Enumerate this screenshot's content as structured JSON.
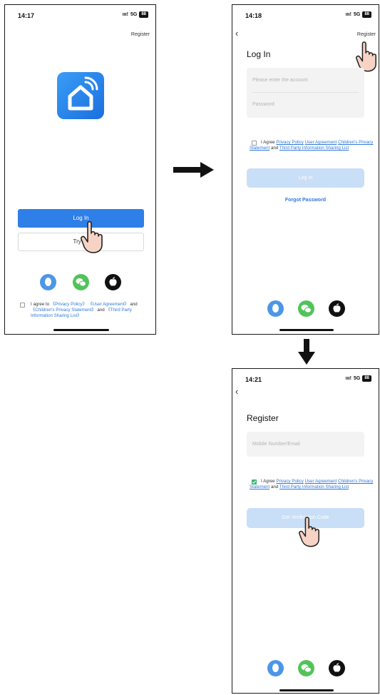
{
  "colors": {
    "accent": "#2f7fe8",
    "link": "#2f78d8",
    "faded_button": "#c9def7",
    "check_green": "#3cb371",
    "qq_blue": "#4c96e8",
    "wechat_green": "#52c35a",
    "apple_black": "#111111"
  },
  "screen1": {
    "time": "14:17",
    "status_right": "5G",
    "battery": "88",
    "register_label": "Register",
    "app_icon": "smart-home-icon",
    "login_button": "Log In",
    "try_button": "Try as",
    "agree_text": "I agree to",
    "privacy_link": "《Privacy Policy》",
    "user_agreement_link": "《User Agreement》",
    "and1": "and",
    "children_link": "《Children's Privacy Statement》",
    "and2": "and",
    "third_party_link": "《Third Party Information Sharing List》"
  },
  "screen2": {
    "time": "14:18",
    "status_right": "5G",
    "battery": "88",
    "register_label": "Register",
    "title": "Log In",
    "account_placeholder": "Please enter the account",
    "password_placeholder": "Password",
    "agree_text": "I Agree",
    "privacy_link": "Privacy Policy",
    "user_agreement_link": "User Agreement",
    "children_link": "Children's Privacy Statement",
    "and_text": "and",
    "third_party_link": "Third Party Information Sharing List",
    "login_button": "Log In",
    "forgot_link": "Forgot Password"
  },
  "screen3": {
    "time": "14:21",
    "status_right": "5G",
    "battery": "88",
    "title": "Register",
    "mobile_placeholder": "Mobile Number/Email",
    "agree_text": "I Agree",
    "privacy_link": "Privacy Policy",
    "user_agreement_link": "User Agreement",
    "children_link": "Children's Privacy Statement",
    "and_text": "and",
    "third_party_link": "Third Party Information Sharing List",
    "verify_button": "Get Verification Code"
  },
  "icons": [
    "qq-icon",
    "wechat-icon",
    "apple-icon",
    "pointer-hand-icon",
    "arrow-right-icon",
    "arrow-down-icon",
    "back-chevron-icon",
    "checkbox-icon"
  ]
}
